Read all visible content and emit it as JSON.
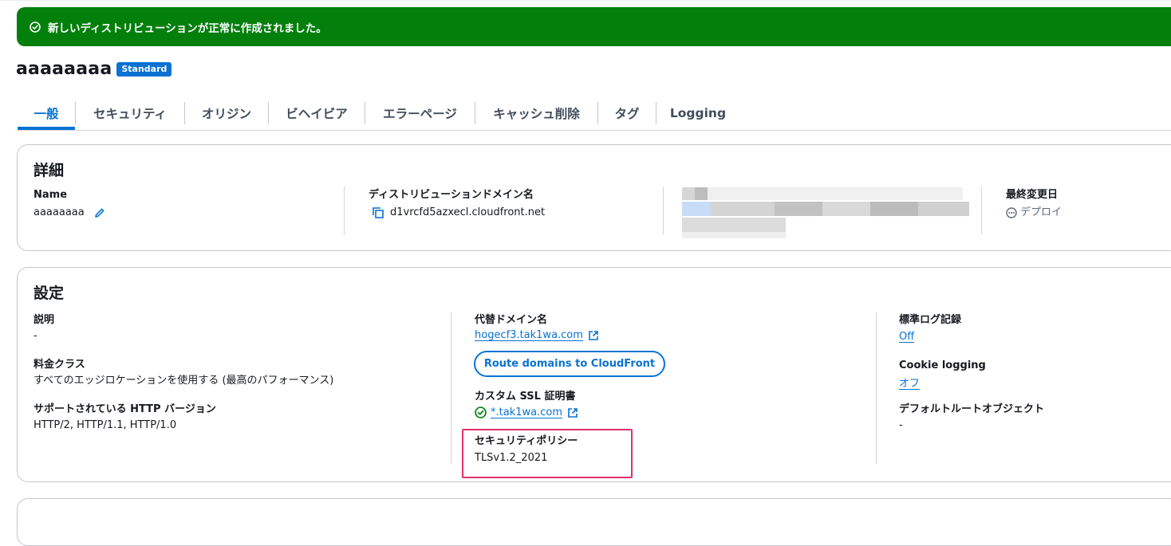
{
  "flash": {
    "message": "新しいディストリビューションが正常に作成されました。",
    "icon": "check-circle-icon",
    "color": "#037f0c"
  },
  "header": {
    "title": "aaaaaaaa",
    "badge": "Standard"
  },
  "tabs": [
    {
      "label": "一般",
      "active": true
    },
    {
      "label": "セキュリティ"
    },
    {
      "label": "オリジン"
    },
    {
      "label": "ビヘイビア"
    },
    {
      "label": "エラーページ"
    },
    {
      "label": "キャッシュ削除"
    },
    {
      "label": "タグ"
    },
    {
      "label": "Logging"
    }
  ],
  "details": {
    "heading": "詳細",
    "name_label": "Name",
    "name_value": "aaaaaaaa",
    "domain_label": "ディストリビューションドメイン名",
    "domain_value": "d1vrcfd5azxecl.cloudfront.net",
    "modified_label": "最終変更日",
    "modified_value": "デプロイ"
  },
  "settings": {
    "heading": "設定",
    "description_label": "説明",
    "description_value": "-",
    "price_class_label": "料金クラス",
    "price_class_value": "すべてのエッジロケーションを使用する (最高のパフォーマンス)",
    "http_label": "サポートされている HTTP バージョン",
    "http_value": "HTTP/2, HTTP/1.1, HTTP/1.0",
    "alt_domain_label": "代替ドメイン名",
    "alt_domain_value": "hogecf3.tak1wa.com",
    "route_button": "Route domains to CloudFront",
    "ssl_label": "カスタム SSL 証明書",
    "ssl_value": "*.tak1wa.com",
    "policy_label": "セキュリティポリシー",
    "policy_value": "TLSv1.2_2021",
    "std_log_label": "標準ログ記録",
    "std_log_value": "Off",
    "cookie_label": "Cookie logging",
    "cookie_value": "オフ",
    "root_obj_label": "デフォルトルートオブジェクト",
    "root_obj_value": "-"
  },
  "colors": {
    "accent": "#0972d3",
    "success": "#037f0c",
    "highlight": "#e0306e"
  }
}
